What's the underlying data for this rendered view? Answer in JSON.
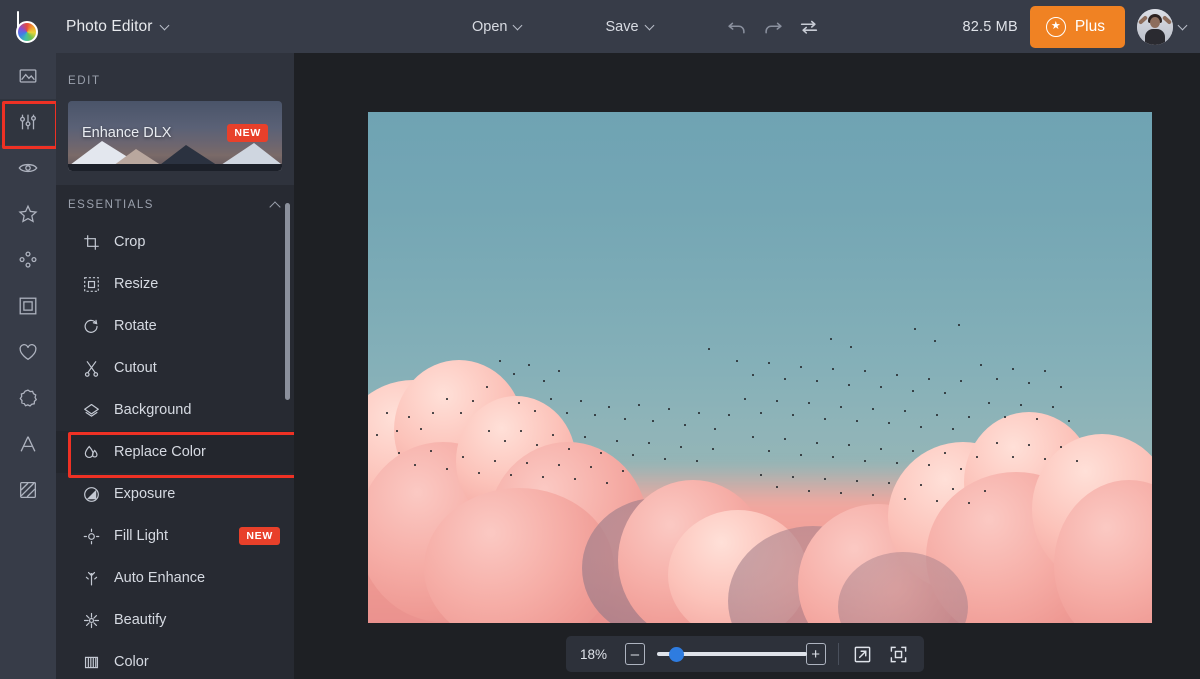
{
  "topbar": {
    "logo_icon": "color-wheel-logo",
    "app_title": "Photo Editor",
    "app_title_caret": "chevron-down-icon",
    "open_label": "Open",
    "save_label": "Save",
    "undo_icon": "undo-icon",
    "redo_icon": "redo-icon",
    "compare_icon": "compare-toggle-icon",
    "filesize": "82.5 MB",
    "plus_label": "Plus",
    "plus_icon": "star-badge-icon",
    "plus_color": "#f08223",
    "avatar_icon": "avatar",
    "avatar_caret": "chevron-down-icon"
  },
  "rail": {
    "items": [
      {
        "icon": "image-icon",
        "name": "rail-item-image",
        "selected": false,
        "highlighted": false
      },
      {
        "icon": "sliders-icon",
        "name": "rail-item-edit",
        "selected": true,
        "highlighted": true
      },
      {
        "icon": "eye-icon",
        "name": "rail-item-effects",
        "selected": false,
        "highlighted": false
      },
      {
        "icon": "star-icon",
        "name": "rail-item-overlays",
        "selected": false,
        "highlighted": false
      },
      {
        "icon": "particles-icon",
        "name": "rail-item-particles",
        "selected": false,
        "highlighted": false
      },
      {
        "icon": "frame-icon",
        "name": "rail-item-frames",
        "selected": false,
        "highlighted": false
      },
      {
        "icon": "heart-icon",
        "name": "rail-item-favorites",
        "selected": false,
        "highlighted": false
      },
      {
        "icon": "sticker-icon",
        "name": "rail-item-stickers",
        "selected": false,
        "highlighted": false
      },
      {
        "icon": "text-icon",
        "name": "rail-item-text",
        "selected": false,
        "highlighted": false
      },
      {
        "icon": "texture-icon",
        "name": "rail-item-textures",
        "selected": false,
        "highlighted": false
      }
    ],
    "highlight_color": "#ee3124"
  },
  "panel": {
    "header": "EDIT",
    "promo": {
      "label": "Enhance DLX",
      "badge": "NEW"
    },
    "group": {
      "title": "ESSENTIALS",
      "collapse_icon": "chevron-up-icon"
    },
    "items": [
      {
        "label": "Crop",
        "icon": "crop-icon",
        "badge": "",
        "highlighted": false
      },
      {
        "label": "Resize",
        "icon": "resize-icon",
        "badge": "",
        "highlighted": false
      },
      {
        "label": "Rotate",
        "icon": "rotate-icon",
        "badge": "",
        "highlighted": false
      },
      {
        "label": "Cutout",
        "icon": "scissors-icon",
        "badge": "",
        "highlighted": false
      },
      {
        "label": "Background",
        "icon": "background-icon",
        "badge": "",
        "highlighted": false
      },
      {
        "label": "Replace Color",
        "icon": "droplet-icon",
        "badge": "",
        "highlighted": true
      },
      {
        "label": "Exposure",
        "icon": "exposure-icon",
        "badge": "",
        "highlighted": false
      },
      {
        "label": "Fill Light",
        "icon": "fill-light-icon",
        "badge": "NEW",
        "highlighted": false
      },
      {
        "label": "Auto Enhance",
        "icon": "auto-enhance-icon",
        "badge": "",
        "highlighted": false
      },
      {
        "label": "Beautify",
        "icon": "beautify-icon",
        "badge": "",
        "highlighted": false
      },
      {
        "label": "Color",
        "icon": "color-icon",
        "badge": "",
        "highlighted": false
      }
    ],
    "highlight_color": "#ee3124",
    "badge_color": "#e8402a"
  },
  "canvas": {
    "image_description": "pink sunset clouds with flock of birds under teal sky"
  },
  "zoombar": {
    "zoom_value": "18%",
    "zoom_out_icon": "minus-icon",
    "zoom_out_label": "–",
    "zoom_in_icon": "plus-icon",
    "zoom_in_label": "+",
    "slider_percent": 13,
    "expand_icon": "expand-arrow-icon",
    "fit_icon": "fit-to-screen-icon",
    "slider_color": "#2e7ce0"
  }
}
